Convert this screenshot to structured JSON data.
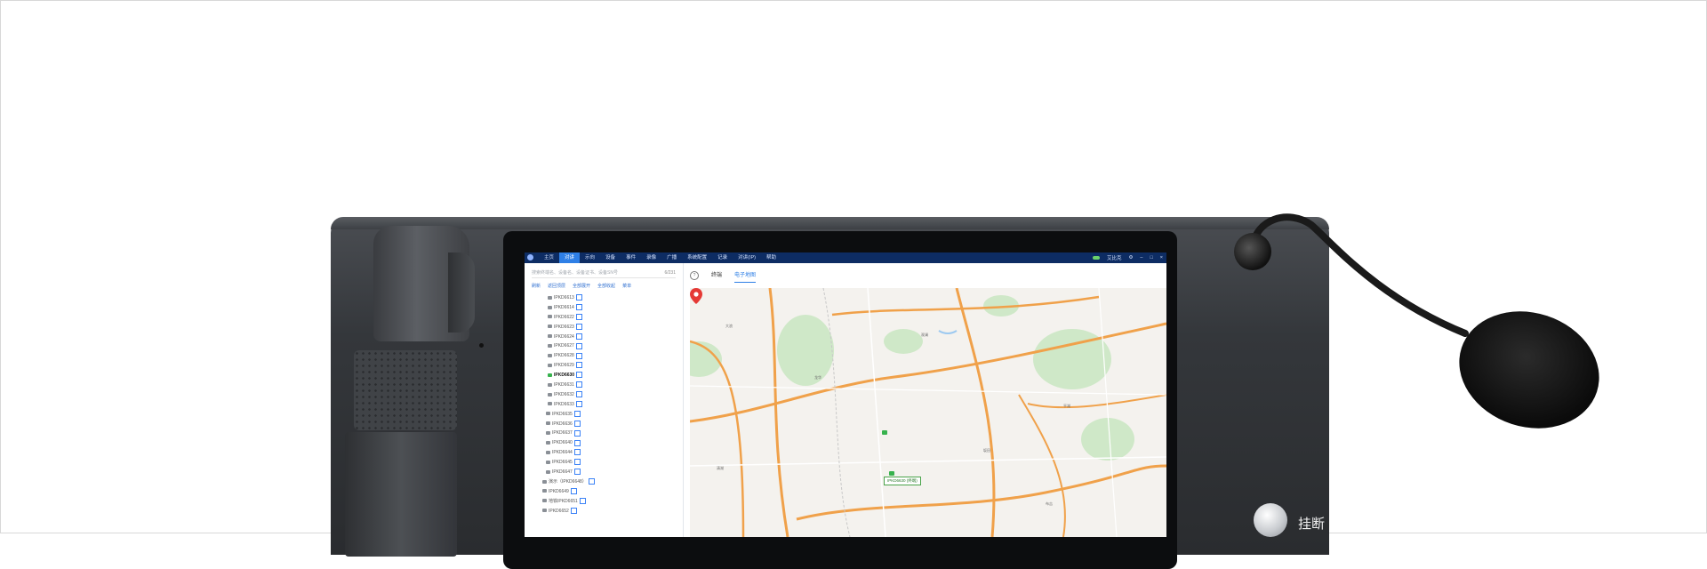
{
  "app": {
    "menu": [
      "主页",
      "对讲",
      "示向",
      "设备",
      "事件",
      "录像",
      "广播",
      "系统配置",
      "记录",
      "对讲(IP)",
      "帮助"
    ],
    "active_menu_index": 1,
    "user": "艾比克"
  },
  "left_panel": {
    "search_placeholder": "搜索终端名、设备名、设备证书、设备SN号",
    "online_count": "6/231",
    "tools": [
      "刷新",
      "返回顶层",
      "全部展开",
      "全部收起",
      "菜单"
    ],
    "tree": [
      {
        "label": "IPKD6613",
        "online": false
      },
      {
        "label": "IPKD6614",
        "online": false
      },
      {
        "label": "IPKD6622",
        "online": false
      },
      {
        "label": "IPKD6623",
        "online": false
      },
      {
        "label": "IPKD6624",
        "online": false
      },
      {
        "label": "IPKD6627",
        "online": false
      },
      {
        "label": "IPKD6628",
        "online": false
      },
      {
        "label": "IPKD6629",
        "online": false
      },
      {
        "label": "IPKD6630",
        "online": true
      },
      {
        "label": "IPKD6631",
        "online": false
      },
      {
        "label": "IPKD6632",
        "online": false
      },
      {
        "label": "IPKD6633",
        "online": false
      },
      {
        "label": "IPKD6635",
        "online": false
      },
      {
        "label": "IPKD6636",
        "online": false
      },
      {
        "label": "IPKD6637",
        "online": false
      },
      {
        "label": "IPKD6640",
        "online": false
      },
      {
        "label": "IPKD6644",
        "online": false
      },
      {
        "label": "IPKD6645",
        "online": false
      },
      {
        "label": "IPKD6647",
        "online": false
      },
      {
        "label": "演示（IPKD6648）",
        "online": false
      },
      {
        "label": "IPKD6649",
        "online": false
      },
      {
        "label": "地铁IPKD6651",
        "online": false
      },
      {
        "label": "IPKD6652",
        "online": false
      }
    ]
  },
  "right_panel": {
    "tabs": [
      "终端",
      "电子地图"
    ],
    "active_tab_index": 1,
    "map_labels": [
      "龙华",
      "观澜",
      "平湖",
      "坂田",
      "布吉",
      "清湖",
      "大浪"
    ],
    "device_label": "IPKD6630 (终端)"
  },
  "device": {
    "hangup_label": "挂断"
  },
  "colors": {
    "titlebar": "#0d2c63",
    "accent": "#2e7fe6",
    "online": "#37b24d",
    "pin": "#e53935"
  }
}
